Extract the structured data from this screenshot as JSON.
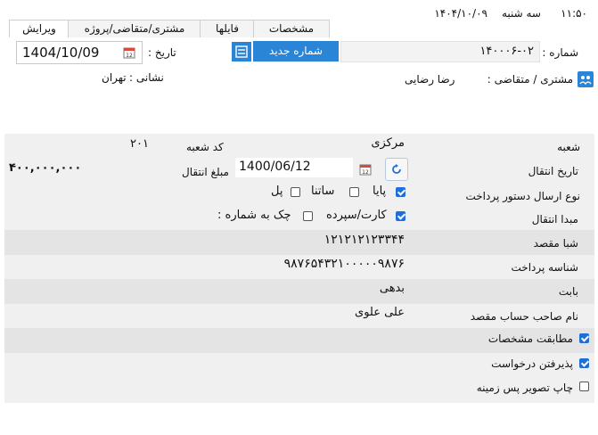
{
  "header": {
    "time": "۱۱:۵۰",
    "weekday": "سه شنبه",
    "date": "۱۴۰۴/۱۰/۰۹"
  },
  "tabs": [
    "ویرایش",
    "مشتری/متقاضی/پروژه",
    "فایلها",
    "مشخصات"
  ],
  "form": {
    "number_label": "شماره :",
    "number_value": "۱۴۰۰۰۶-۰۲",
    "new_number_button": "شماره جدید",
    "date_label": "تاریخ :",
    "date_value": "1404/10/09",
    "customer_label": "مشتری / متقاضی :",
    "customer_value": "رضا رضایی",
    "address_label": "نشانی :",
    "address_value": "تهران"
  },
  "details": {
    "branch_label": "شعبه",
    "branch_value": "مرکزی",
    "branch_code_label": "کد شعبه",
    "branch_code_value": "۲۰۱",
    "transfer_date_label": "تاریخ انتقال",
    "transfer_date_value": "1400/06/12",
    "transfer_amount_label": "مبلغ انتقال",
    "transfer_amount_value": "۴۰۰,۰۰۰,۰۰۰",
    "order_type_label": "نوع ارسال دستور پرداخت",
    "order_types": [
      {
        "label": "پایا",
        "checked": true
      },
      {
        "label": "ساتنا",
        "checked": false
      },
      {
        "label": "پل",
        "checked": false
      }
    ],
    "origin_label": "مبدا انتقال",
    "origins": [
      {
        "label": "کارت/سپرده",
        "checked": true
      },
      {
        "label": "چک به شماره :",
        "checked": false
      }
    ],
    "sheba_label": "شبا مقصد",
    "sheba_value": "۱۲۱۲۱۲۱۲۳۳۴۴",
    "payment_id_label": "شناسه پرداخت",
    "payment_id_value": "۹۸۷۶۵۴۳۲۱۰۰۰۰۰۹۸۷۶",
    "reason_label": "بابت",
    "reason_value": "بدهی",
    "owner_label": "نام صاحب حساب مقصد",
    "owner_value": "علی علوی",
    "options": [
      {
        "label": "مطابقت مشخصات",
        "checked": true
      },
      {
        "label": "پذیرفتن درخواست",
        "checked": true
      },
      {
        "label": "چاپ تصویر پس زمینه",
        "checked": false
      }
    ]
  },
  "colors": {
    "accent": "#2a85d6",
    "checked": "#1e6fd9",
    "row_band": "#e4e4e4",
    "grid_bg": "#f0f0f0"
  }
}
